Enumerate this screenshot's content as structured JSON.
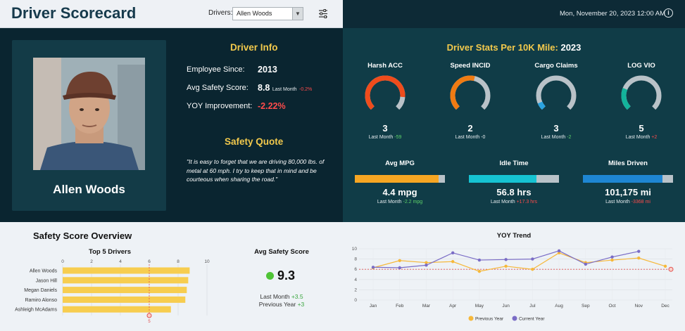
{
  "header": {
    "title": "Driver Scorecard",
    "drivers_label": "Drivers:",
    "driver_selected": "Allen Woods",
    "datetime": "Mon, November 20, 2023 12:00 AM",
    "info_symbol": "i"
  },
  "driver_info": {
    "title": "Driver Info",
    "employee_since_label": "Employee Since:",
    "employee_since": "2013",
    "avg_safety_label": "Avg Safety Score:",
    "avg_safety": "8.8",
    "avg_safety_lm_label": "Last Month",
    "avg_safety_lm": "-0.2%",
    "yoy_label": "YOY Improvement:",
    "yoy": "-2.22%",
    "driver_name": "Allen Woods"
  },
  "quote": {
    "title": "Safety Quote",
    "text": "\"It is easy to forget that we are driving 80,000 lbs. of metal at 60 mph. I try to keep that in mind and be courteous when sharing the road.\""
  },
  "stats": {
    "title": "Driver Stats Per 10K Mile:",
    "year": "2023",
    "gauges": [
      {
        "label": "Harsh ACC",
        "value": "3",
        "lm_label": "Last Month",
        "lm": "-59",
        "fraction": 0.85,
        "color": "#ef4c1c",
        "lm_color": "#5ed36a"
      },
      {
        "label": "Speed INCID",
        "value": "2",
        "lm_label": "Last Month",
        "lm": "-0",
        "fraction": 0.55,
        "color": "#f07b12",
        "lm_color": "#e6ecef"
      },
      {
        "label": "Cargo Claims",
        "value": "3",
        "lm_label": "Last Month",
        "lm": "-2",
        "fraction": 0.08,
        "color": "#2ba3e0",
        "lm_color": "#5ed36a"
      },
      {
        "label": "LOG VIO",
        "value": "5",
        "lm_label": "Last Month",
        "lm": "+2",
        "fraction": 0.25,
        "color": "#13b39b",
        "lm_color": "#ff4b4b"
      }
    ],
    "bars": [
      {
        "label": "Avg MPG",
        "value": "4.4 mpg",
        "lm_label": "Last Month",
        "lm": "-2.2 mpg",
        "fraction": 0.93,
        "color": "#f6a623",
        "lm_color": "#5ed36a"
      },
      {
        "label": "Idle Time",
        "value": "56.8 hrs",
        "lm_label": "Last Month",
        "lm": "+17.3 hrs",
        "fraction": 0.75,
        "color": "#16c3d2",
        "lm_color": "#ff4b4b"
      },
      {
        "label": "Miles Driven",
        "value": "101,175 mi",
        "lm_label": "Last Month",
        "lm": "-3368 mi",
        "fraction": 0.88,
        "color": "#1e86d3",
        "lm_color": "#ff4b4b"
      }
    ]
  },
  "safety_overview": {
    "title": "Safety Score Overview",
    "avg_title": "Avg Safety Score",
    "avg_value": "9.3",
    "last_month_label": "Last Month",
    "last_month": "+3.5",
    "prev_year_label": "Previous Year",
    "prev_year": "+3"
  },
  "chart_data": [
    {
      "type": "bar",
      "orientation": "horizontal",
      "title": "Top 5 Drivers",
      "categories": [
        "Allen Woods",
        "Jason Hill",
        "Megan Daniels",
        "Ramiro Alonso",
        "Ashleigh McAdams"
      ],
      "values": [
        8.8,
        8.7,
        8.6,
        8.5,
        7.5
      ],
      "xlim": [
        0,
        10
      ],
      "ticks": [
        "0",
        "2",
        "4",
        "6",
        "8",
        "10"
      ],
      "reference_line": {
        "value": 6,
        "label": "5"
      },
      "bar_color": "#f7cd4f",
      "grid": true
    },
    {
      "type": "line",
      "title": "YOY Trend",
      "categories": [
        "Jan",
        "Feb",
        "Mar",
        "Apr",
        "May",
        "Jun",
        "Jul",
        "Aug",
        "Sep",
        "Oct",
        "Nov",
        "Dec"
      ],
      "ylim": [
        0,
        10
      ],
      "yticks": [
        "0",
        "2",
        "4",
        "6",
        "8",
        "10"
      ],
      "reference_line": {
        "value": 6,
        "color": "#e05050"
      },
      "series": [
        {
          "name": "Previous Year",
          "color": "#f6b83a",
          "values": [
            6.3,
            7.7,
            7.3,
            7.5,
            5.6,
            6.6,
            6.0,
            9.2,
            7.3,
            7.8,
            8.2,
            6.6
          ]
        },
        {
          "name": "Current Year",
          "color": "#7a6cc6",
          "values": [
            6.4,
            6.3,
            6.8,
            9.2,
            7.8,
            7.9,
            8.0,
            9.6,
            7.0,
            8.4,
            9.5,
            null
          ]
        }
      ],
      "legend": "bottom",
      "grid": true
    }
  ]
}
